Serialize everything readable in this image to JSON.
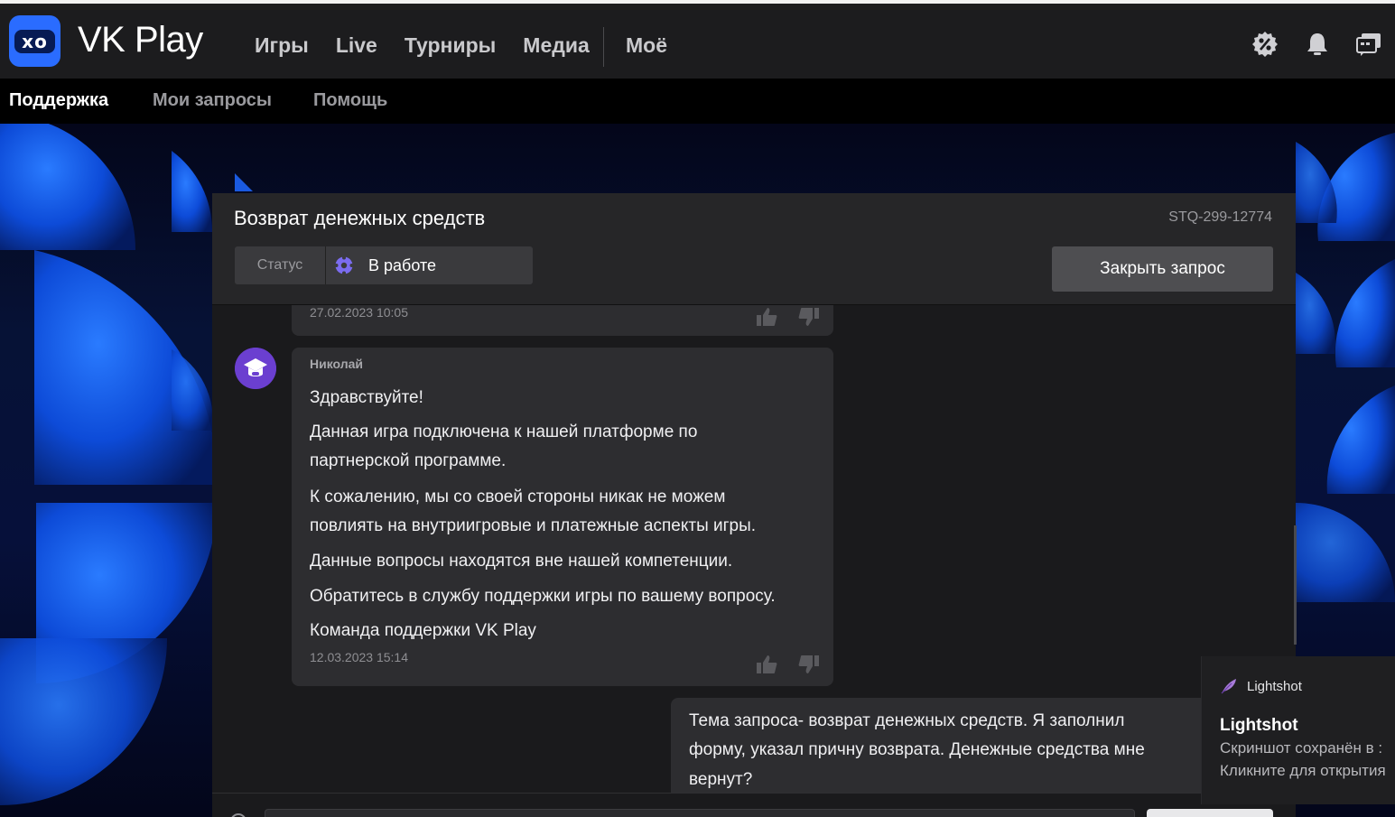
{
  "header": {
    "brand": "VK Play",
    "logo_text": "xo",
    "nav": [
      "Игры",
      "Live",
      "Турниры",
      "Медиа"
    ],
    "nav_more": "Моё",
    "icons": [
      "discount-icon",
      "bell-icon",
      "messages-icon"
    ]
  },
  "subnav": {
    "items": [
      "Поддержка",
      "Мои запросы",
      "Помощь"
    ],
    "active": "Поддержка"
  },
  "request": {
    "title": "Возврат денежных средств",
    "id": "STQ-299-12774",
    "status_label": "Статус",
    "status_value": "В работе",
    "close_button": "Закрыть запрос"
  },
  "messages": {
    "previous_time": "27.02.2023 10:05",
    "support": {
      "author": "Николай",
      "lines": [
        "Здравствуйте!",
        "Данная игра подключена к нашей платформе по",
        "партнерской программе.",
        "К сожалению, мы со своей стороны никак не можем",
        "повлиять на внутриигровые и платежные аспекты игры.",
        "Данные вопросы находятся вне нашей компетенции.",
        "Обратитесь в службу поддержки игры по вашему вопросу.",
        "Команда поддержки VK Play"
      ],
      "time": "12.03.2023 15:14"
    },
    "user": {
      "lines": [
        "Тема запроса- возврат денежных средств. Я заполнил",
        "форму, указал причну возврата. Денежные средства мне",
        "вернут?"
      ]
    }
  },
  "toast": {
    "app": "Lightshot",
    "title": "Lightshot",
    "line1": "Скриншот сохранён в :",
    "line2": "Кликните для открытия"
  },
  "colors": {
    "accent_blue": "#2a6cff",
    "avatar_purple": "#6b3fd0",
    "status_icon": "#7b6cf0"
  }
}
